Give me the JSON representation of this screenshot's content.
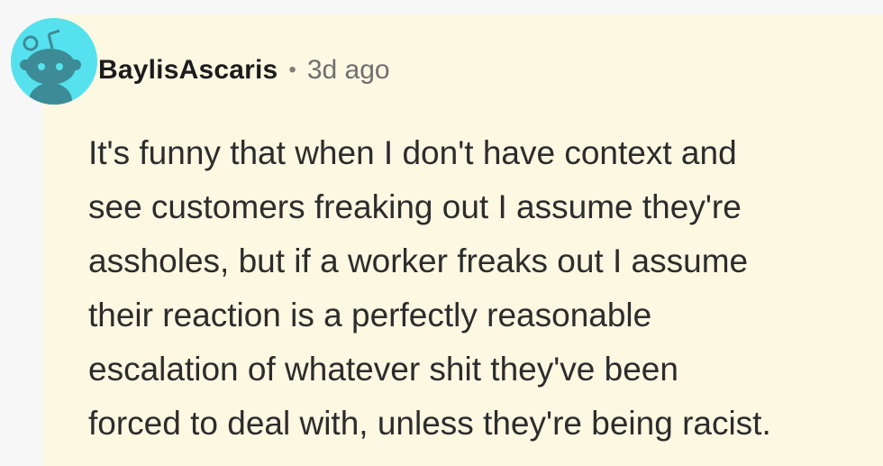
{
  "comment": {
    "author": "BaylisAscaris",
    "separator": "•",
    "timestamp": "3d ago",
    "body_lines": [
      "It's funny that when I don't have context and",
      "see customers freaking out I assume they're",
      "assholes, but if a worker freaks out I assume",
      "their reaction is a perfectly reasonable",
      "escalation of whatever shit they've been",
      "forced to deal with, unless they're being racist."
    ]
  },
  "colors": {
    "page_background": "#f7f7f7",
    "card_background": "#fdf8e2",
    "avatar_background": "#55e2ee",
    "avatar_figure": "#3d8b96",
    "username": "#1c1c1c",
    "timestamp": "#6f6f6f",
    "body_text": "#2c2c2c"
  },
  "icons": {
    "avatar": "snoo-avatar-icon"
  }
}
